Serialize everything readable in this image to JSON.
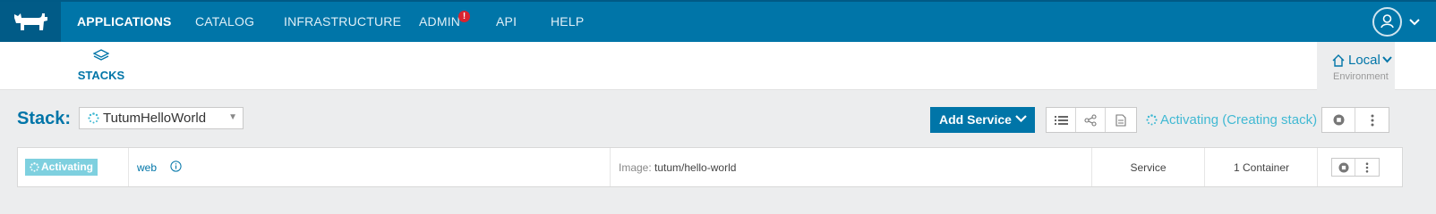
{
  "nav": {
    "logo_icon": "rancher-logo-icon",
    "items": [
      {
        "label": "APPLICATIONS",
        "active": true
      },
      {
        "label": "CATALOG"
      },
      {
        "label": "INFRASTRUCTURE"
      },
      {
        "label": "ADMIN",
        "badge": "!"
      },
      {
        "label": "API"
      },
      {
        "label": "HELP"
      }
    ],
    "user_icon": "user-icon"
  },
  "subnav": {
    "stacks_label": "STACKS",
    "environment": {
      "name": "Local",
      "label": "Environment"
    }
  },
  "stack": {
    "title": "Stack:",
    "selected": "TutumHelloWorld",
    "add_service_label": "Add Service",
    "state": "Activating (Creating stack)"
  },
  "services": [
    {
      "state": "Activating",
      "name": "web",
      "image_label": "Image:",
      "image": "tutum/hello-world",
      "kind": "Service",
      "containers": "1 Container"
    }
  ],
  "colors": {
    "brand": "#0075a8",
    "brand_dark": "#015b87",
    "activating": "#41b9d3",
    "alert": "#d9232f"
  }
}
